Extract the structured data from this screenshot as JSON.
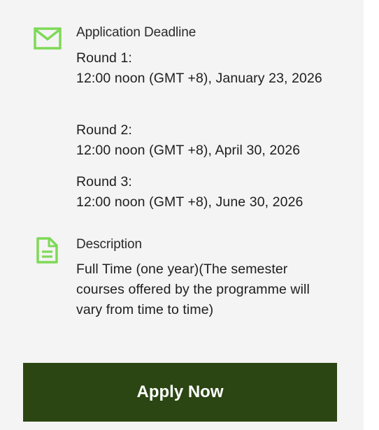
{
  "deadline": {
    "label": "Application Deadline",
    "rounds": [
      {
        "title": "Round 1:",
        "date": "12:00 noon (GMT +8), January 23, 2026"
      },
      {
        "title": "Round 2:",
        "date": "12:00 noon (GMT +8), April 30, 2026"
      },
      {
        "title": "Round 3:",
        "date": "12:00 noon (GMT +8), June 30, 2026"
      }
    ]
  },
  "description": {
    "label": "Description",
    "text": "Full Time (one year)(The semester courses offered by the programme will vary from time to time)"
  },
  "apply_button": {
    "label": "Apply Now"
  },
  "colors": {
    "icon_green": "#7ed957",
    "button_green": "#2b4513",
    "panel_bg": "#f4f4f4"
  },
  "icons": {
    "deadline": "envelope-icon",
    "description": "document-icon"
  }
}
